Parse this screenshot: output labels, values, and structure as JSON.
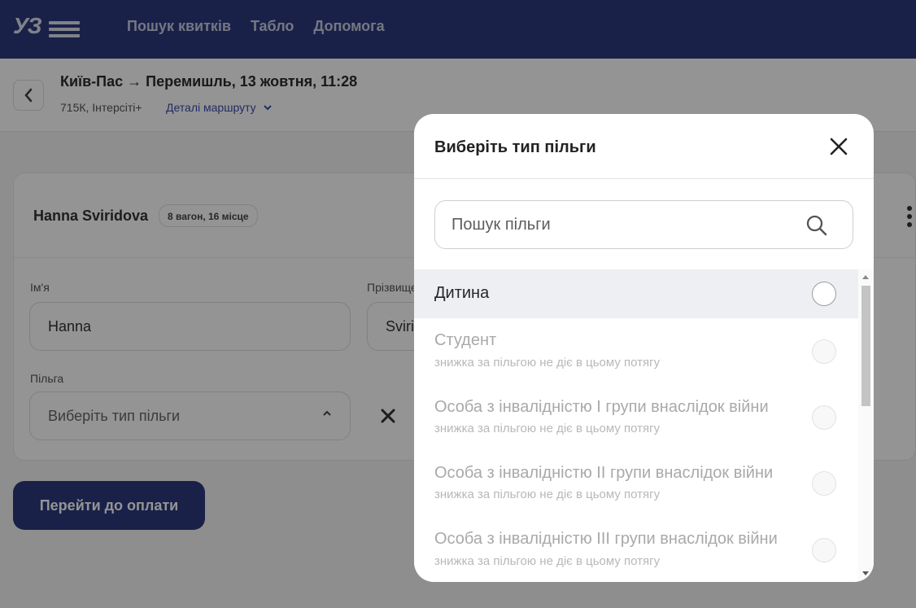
{
  "header": {
    "logo_text": "УЗ",
    "nav": [
      "Пошук квитків",
      "Табло",
      "Допомога"
    ]
  },
  "route": {
    "title": "Київ-Пас → Перемишль, 13 жовтня, 11:28",
    "train": "715К, Інтерсіті+",
    "details_link": "Деталі маршруту"
  },
  "passenger": {
    "name": "Hanna Sviridova",
    "seat_badge": "8 вагон, 16 місце",
    "first_name_label": "Ім'я",
    "first_name_value": "Hanna",
    "last_name_label": "Прізвище",
    "last_name_value": "Sviri",
    "benefit_label": "Пільга",
    "benefit_placeholder": "Виберіть тип пільги"
  },
  "pay_button": "Перейти до оплати",
  "modal": {
    "title": "Виберіть тип пільги",
    "search_placeholder": "Пошук пільги",
    "options": [
      {
        "label": "Дитина",
        "note": "",
        "enabled": true,
        "selected": false
      },
      {
        "label": "Студент",
        "note": "знижка за пільгою не діє в цьому потягу",
        "enabled": false,
        "selected": false
      },
      {
        "label": "Особа з інвалідністю I групи внаслідок війни",
        "note": "знижка за пільгою не діє в цьому потягу",
        "enabled": false,
        "selected": false
      },
      {
        "label": "Особа з інвалідністю II групи внаслідок війни",
        "note": "знижка за пільгою не діє в цьому потягу",
        "enabled": false,
        "selected": false
      },
      {
        "label": "Особа з інвалідністю III групи внаслідок війни",
        "note": "знижка за пільгою не діє в цьому потягу",
        "enabled": false,
        "selected": false
      }
    ]
  },
  "colors": {
    "brand": "#2d3a7c",
    "link": "#3a4fa8",
    "highlight_row": "#eeeff3"
  }
}
